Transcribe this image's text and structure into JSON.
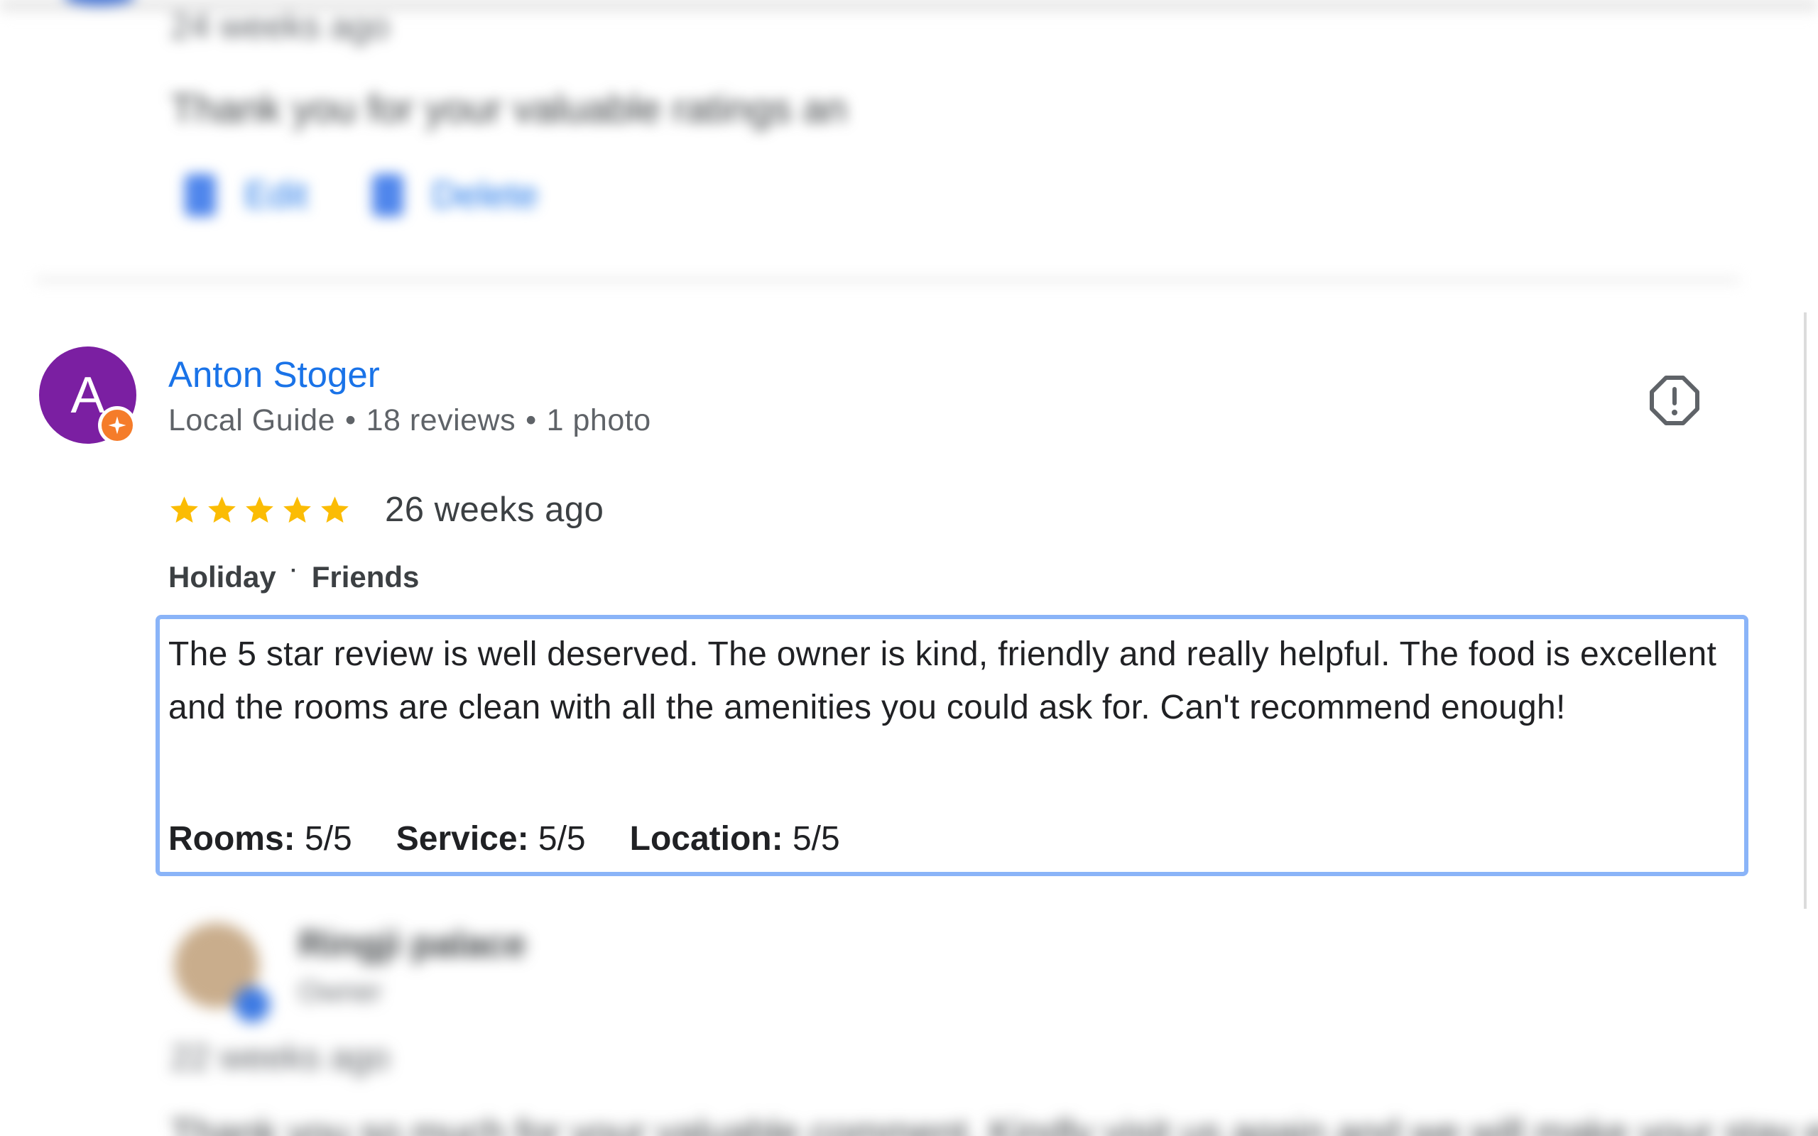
{
  "previous_review": {
    "time": "24 weeks ago",
    "owner_reply": "Thank you for your valuable ratings an",
    "edit_label": "Edit",
    "delete_label": "Delete"
  },
  "review": {
    "reviewer": {
      "avatar_letter": "A",
      "avatar_color": "#7b1fa2",
      "name": "Anton Stoger",
      "local_guide": "Local Guide",
      "reviews_count": "18 reviews",
      "photos_count": "1 photo"
    },
    "rating": {
      "stars": 5,
      "max": 5,
      "star_color": "#fbbc04"
    },
    "time": "26 weeks ago",
    "tags": {
      "trip_type": "Holiday",
      "travel_group": "Friends"
    },
    "text": "The 5 star review is well deserved. The owner is kind, friendly and really helpful. The food is excellent and the rooms are clean with all the amenities you could ask for. Can't recommend enough!",
    "subratings": [
      {
        "label": "Rooms:",
        "value": "5/5"
      },
      {
        "label": "Service:",
        "value": "5/5"
      },
      {
        "label": "Location:",
        "value": "5/5"
      }
    ],
    "report_icon": "report-flag-icon",
    "highlight_color": "#8ab4f8",
    "name_color": "#1a73e8"
  },
  "next_review": {
    "name": "Ringji palace",
    "meta": "Owner",
    "time": "22 weeks ago",
    "text": "Thank you so much for your valuable comment. Kindly visit us again and we will make your stay even better."
  }
}
